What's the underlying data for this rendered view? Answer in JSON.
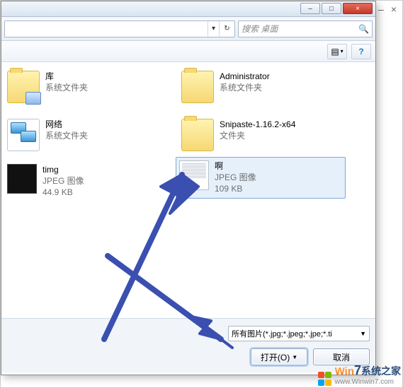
{
  "outer_window": {
    "min": "–",
    "close": "×"
  },
  "titlebar": {
    "min": "–",
    "max": "□",
    "close": "×"
  },
  "nav": {
    "dropdown": "▾",
    "refresh": "↻"
  },
  "search": {
    "placeholder": "搜索 桌面",
    "icon": "🔍"
  },
  "toolbar": {
    "view": "▤",
    "help": "?"
  },
  "items": {
    "lib": {
      "name": "库",
      "type": "系统文件夹"
    },
    "network": {
      "name": "网络",
      "type": "系统文件夹"
    },
    "timg": {
      "name": "timg",
      "type": "JPEG 图像",
      "size": "44.9 KB"
    },
    "admin": {
      "name": "Administrator",
      "type": "系统文件夹"
    },
    "snip": {
      "name": "Snipaste-1.16.2-x64",
      "type": "文件夹"
    },
    "a": {
      "name": "啊",
      "type": "JPEG 图像",
      "size": "109 KB"
    }
  },
  "footer": {
    "filter": "所有图片(*.jpg;*.jpeg;*.jpe;*.ti",
    "open": "打开(O)",
    "cancel": "取消"
  },
  "watermark": {
    "text1": "Win",
    "text2": "7",
    "text3": "系统之家",
    "url": "www.Winwin7.com"
  }
}
